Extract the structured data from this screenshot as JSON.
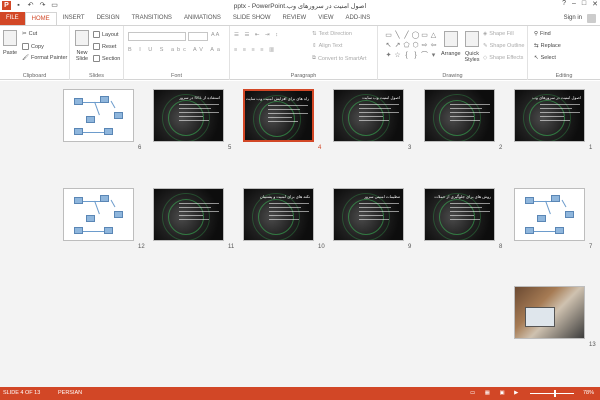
{
  "window": {
    "title": "اصول امنیت در سرورهای وب.pptx - PowerPoint",
    "signin": "Sign in",
    "controls": [
      "?",
      "–",
      "□",
      "✕"
    ]
  },
  "tabs": [
    "FILE",
    "HOME",
    "INSERT",
    "DESIGN",
    "TRANSITIONS",
    "ANIMATIONS",
    "SLIDE SHOW",
    "REVIEW",
    "VIEW",
    "ADD-INS"
  ],
  "active_tab": "HOME",
  "ribbon": {
    "clipboard": {
      "label": "Clipboard",
      "paste": "Paste",
      "cut": "Cut",
      "copy": "Copy",
      "format_painter": "Format Painter"
    },
    "slides": {
      "label": "Slides",
      "new_slide": "New Slide",
      "layout": "Layout",
      "reset": "Reset",
      "section": "Section"
    },
    "font": {
      "label": "Font"
    },
    "paragraph": {
      "label": "Paragraph",
      "text_direction": "Text Direction",
      "align_text": "Align Text",
      "convert": "Convert to SmartArt"
    },
    "drawing": {
      "label": "Drawing",
      "arrange": "Arrange",
      "quick_styles": "Quick Styles",
      "shape_fill": "Shape Fill",
      "shape_outline": "Shape Outline",
      "shape_effects": "Shape Effects"
    },
    "editing": {
      "label": "Editing",
      "find": "Find",
      "replace": "Replace",
      "select": "Select"
    }
  },
  "slides": [
    {
      "num": "1",
      "kind": "dark",
      "title": "اصول امنیت در سرورهای وب"
    },
    {
      "num": "2",
      "kind": "dark",
      "title": ""
    },
    {
      "num": "3",
      "kind": "dark",
      "title": "اصول امنیت وب سایت"
    },
    {
      "num": "4",
      "kind": "dark",
      "title": "راه های برای افزایش امنیت وب سایت",
      "selected": true
    },
    {
      "num": "5",
      "kind": "dark",
      "title": "استفاده از SSL در سرور"
    },
    {
      "num": "6",
      "kind": "white",
      "title": ""
    },
    {
      "num": "7",
      "kind": "white",
      "title": ""
    },
    {
      "num": "8",
      "kind": "dark",
      "title": "روش های برای جلوگیری از حملات"
    },
    {
      "num": "9",
      "kind": "dark",
      "title": "تنظیمات امنیتی سرور"
    },
    {
      "num": "10",
      "kind": "dark",
      "title": "نکته های برای امنیت و پشتیبان"
    },
    {
      "num": "11",
      "kind": "dark",
      "title": ""
    },
    {
      "num": "12",
      "kind": "white",
      "title": ""
    },
    {
      "num": "13",
      "kind": "photo",
      "title": ""
    }
  ],
  "status": {
    "slide_of": "SLIDE 4 OF 13",
    "language": "PERSIAN",
    "zoom": "78%"
  },
  "colors": {
    "accent": "#d24726"
  }
}
